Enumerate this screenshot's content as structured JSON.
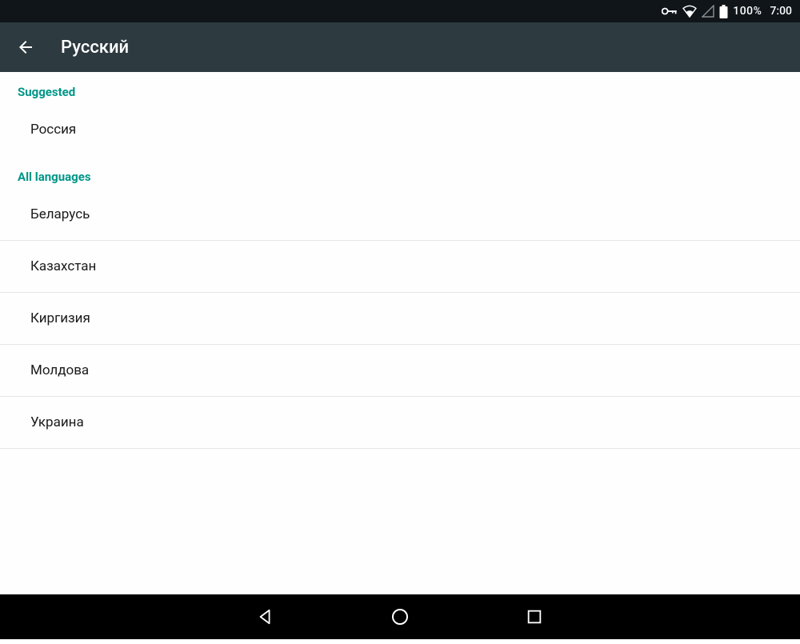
{
  "status_bar": {
    "battery_pct": "100%",
    "clock": "7:00"
  },
  "app_bar": {
    "title": "Русский"
  },
  "sections": {
    "suggested_header": "Suggested",
    "suggested_items": [
      "Россия"
    ],
    "all_header": "All languages",
    "all_items": [
      "Беларусь",
      "Казахстан",
      "Киргизия",
      "Молдова",
      "Украина"
    ]
  }
}
